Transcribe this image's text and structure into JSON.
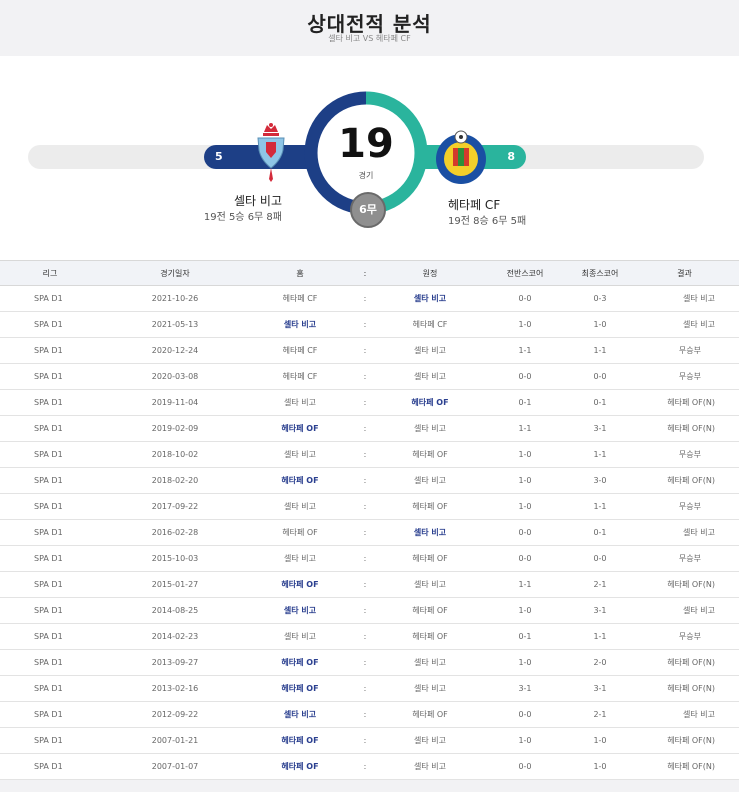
{
  "header": {
    "title": "상대전적 분석",
    "subtitle": "셀타 비고 VS 헤타페 CF"
  },
  "summary": {
    "total": "19",
    "total_label": "경기",
    "draws": "6무",
    "home_wins": "5",
    "away_wins": "8",
    "home_name": "셀타 비고",
    "home_record": "19전 5승 6무 8패",
    "away_name": "헤타페 CF",
    "away_record": "19전 8승 6무 5패",
    "colors": {
      "home": "#1d3f86",
      "away": "#2ab49d",
      "draw": "#8f8f8f"
    }
  },
  "table": {
    "headers": [
      "리그",
      "경기일자",
      "홈",
      ":",
      "원정",
      "전반스코어",
      "최종스코어",
      "결과"
    ],
    "rows": [
      {
        "league": "SPA D1",
        "date": "2021-10-26",
        "home": "헤타페 CF",
        "sep": ":",
        "away": "셀타 비고",
        "ht": "0-0",
        "ft": "0-3",
        "result": "셀타 비고",
        "winner": "away"
      },
      {
        "league": "SPA D1",
        "date": "2021-05-13",
        "home": "셀타 비고",
        "sep": ":",
        "away": "헤타페 CF",
        "ht": "1-0",
        "ft": "1-0",
        "result": "셀타 비고",
        "winner": "home"
      },
      {
        "league": "SPA D1",
        "date": "2020-12-24",
        "home": "헤타페 CF",
        "sep": ":",
        "away": "셀타 비고",
        "ht": "1-1",
        "ft": "1-1",
        "result": "무승부",
        "winner": "draw"
      },
      {
        "league": "SPA D1",
        "date": "2020-03-08",
        "home": "헤타페 CF",
        "sep": ":",
        "away": "셀타 비고",
        "ht": "0-0",
        "ft": "0-0",
        "result": "무승부",
        "winner": "draw"
      },
      {
        "league": "SPA D1",
        "date": "2019-11-04",
        "home": "셀타 비고",
        "sep": ":",
        "away": "헤타페 OF",
        "ht": "0-1",
        "ft": "0-1",
        "result": "헤타페 OF(N)",
        "winner": "away"
      },
      {
        "league": "SPA D1",
        "date": "2019-02-09",
        "home": "헤타페 OF",
        "sep": ":",
        "away": "셀타 비고",
        "ht": "1-1",
        "ft": "3-1",
        "result": "헤타페 OF(N)",
        "winner": "home"
      },
      {
        "league": "SPA D1",
        "date": "2018-10-02",
        "home": "셀타 비고",
        "sep": ":",
        "away": "헤타페 OF",
        "ht": "1-0",
        "ft": "1-1",
        "result": "무승부",
        "winner": "draw"
      },
      {
        "league": "SPA D1",
        "date": "2018-02-20",
        "home": "헤타페 OF",
        "sep": ":",
        "away": "셀타 비고",
        "ht": "1-0",
        "ft": "3-0",
        "result": "헤타페 OF(N)",
        "winner": "home"
      },
      {
        "league": "SPA D1",
        "date": "2017-09-22",
        "home": "셀타 비고",
        "sep": ":",
        "away": "헤타페 OF",
        "ht": "1-0",
        "ft": "1-1",
        "result": "무승부",
        "winner": "draw"
      },
      {
        "league": "SPA D1",
        "date": "2016-02-28",
        "home": "헤타페 OF",
        "sep": ":",
        "away": "셀타 비고",
        "ht": "0-0",
        "ft": "0-1",
        "result": "셀타 비고",
        "winner": "away"
      },
      {
        "league": "SPA D1",
        "date": "2015-10-03",
        "home": "셀타 비고",
        "sep": ":",
        "away": "헤타페 OF",
        "ht": "0-0",
        "ft": "0-0",
        "result": "무승부",
        "winner": "draw"
      },
      {
        "league": "SPA D1",
        "date": "2015-01-27",
        "home": "헤타페 OF",
        "sep": ":",
        "away": "셀타 비고",
        "ht": "1-1",
        "ft": "2-1",
        "result": "헤타페 OF(N)",
        "winner": "home"
      },
      {
        "league": "SPA D1",
        "date": "2014-08-25",
        "home": "셀타 비고",
        "sep": ":",
        "away": "헤타페 OF",
        "ht": "1-0",
        "ft": "3-1",
        "result": "셀타 비고",
        "winner": "home"
      },
      {
        "league": "SPA D1",
        "date": "2014-02-23",
        "home": "셀타 비고",
        "sep": ":",
        "away": "헤타페 OF",
        "ht": "0-1",
        "ft": "1-1",
        "result": "무승부",
        "winner": "draw"
      },
      {
        "league": "SPA D1",
        "date": "2013-09-27",
        "home": "헤타페 OF",
        "sep": ":",
        "away": "셀타 비고",
        "ht": "1-0",
        "ft": "2-0",
        "result": "헤타페 OF(N)",
        "winner": "home"
      },
      {
        "league": "SPA D1",
        "date": "2013-02-16",
        "home": "헤타페 OF",
        "sep": ":",
        "away": "셀타 비고",
        "ht": "3-1",
        "ft": "3-1",
        "result": "헤타페 OF(N)",
        "winner": "home"
      },
      {
        "league": "SPA D1",
        "date": "2012-09-22",
        "home": "셀타 비고",
        "sep": ":",
        "away": "헤타페 OF",
        "ht": "0-0",
        "ft": "2-1",
        "result": "셀타 비고",
        "winner": "home"
      },
      {
        "league": "SPA D1",
        "date": "2007-01-21",
        "home": "헤타페 OF",
        "sep": ":",
        "away": "셀타 비고",
        "ht": "1-0",
        "ft": "1-0",
        "result": "헤타페 OF(N)",
        "winner": "home"
      },
      {
        "league": "SPA D1",
        "date": "2007-01-07",
        "home": "헤타페 OF",
        "sep": ":",
        "away": "셀타 비고",
        "ht": "0-0",
        "ft": "1-0",
        "result": "헤타페 OF(N)",
        "winner": "home"
      }
    ]
  }
}
